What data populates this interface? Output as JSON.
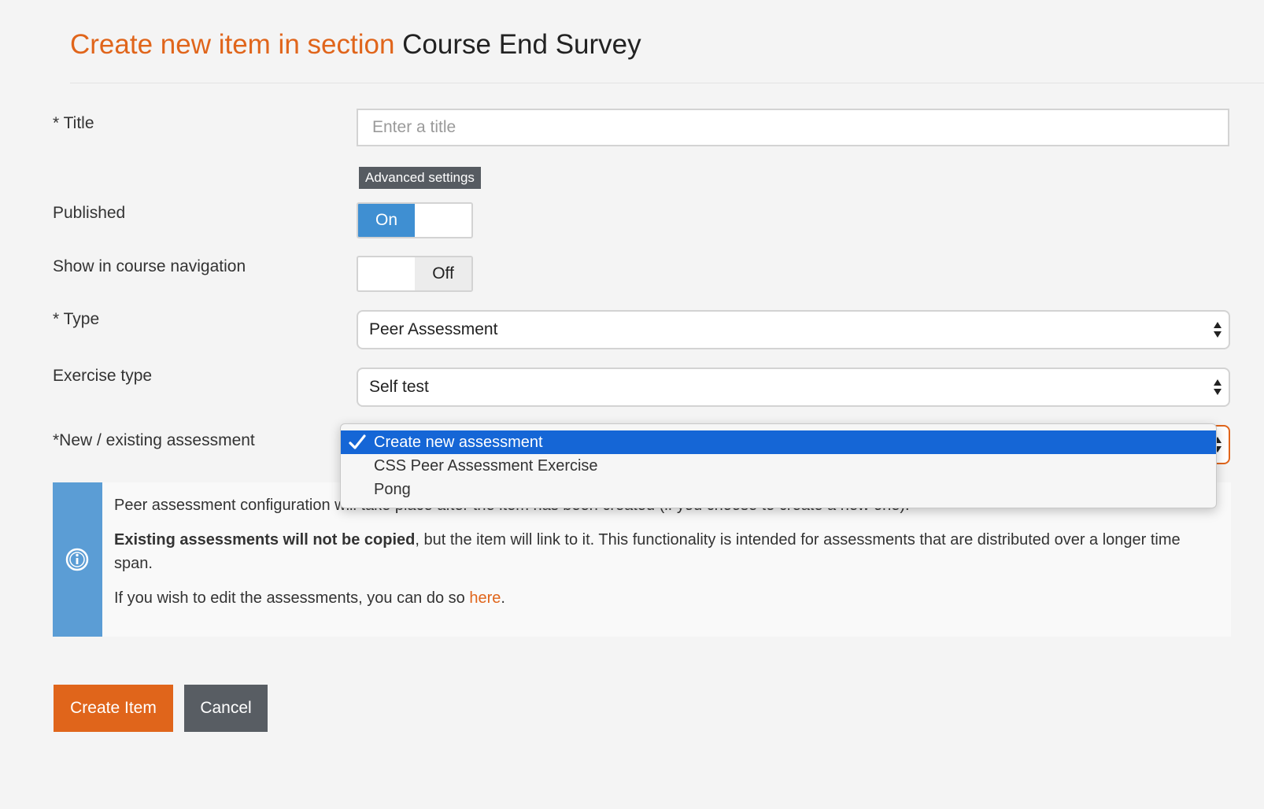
{
  "page": {
    "heading_prefix": "Create new item in section",
    "section_name": "Course End Survey"
  },
  "form": {
    "title": {
      "label": "* Title",
      "placeholder": "Enter a title",
      "value": ""
    },
    "advanced_settings_label": "Advanced settings",
    "published": {
      "label": "Published",
      "on_label": "On",
      "state": "on"
    },
    "show_in_nav": {
      "label": "Show in course navigation",
      "off_label": "Off",
      "state": "off"
    },
    "type": {
      "label": "* Type",
      "value": "Peer Assessment"
    },
    "exercise_type": {
      "label": "Exercise type",
      "value": "Self test"
    },
    "assessment": {
      "label": "*New / existing assessment",
      "options": [
        "Create new assessment",
        "CSS Peer Assessment Exercise",
        "Pong"
      ],
      "selected_index": 0
    }
  },
  "info": {
    "para1_visible": "Peer assessment configuration",
    "para1_hidden_tail": " will take place after the item has been created (if you choose to create a new one).",
    "para2_bold": "Existing assessments will not be copied",
    "para2_rest": ", but the item will link to it. This functionality is intended for assessments that are distributed over a longer time span.",
    "para3_text": "If you wish to edit the assessments, you can do so ",
    "para3_link": "here",
    "para3_end": "."
  },
  "actions": {
    "create_label": "Create Item",
    "cancel_label": "Cancel"
  },
  "colors": {
    "accent": "#e0651b",
    "toggle_on": "#3f8fd2",
    "dropdown_selected": "#1566d6",
    "info_bar": "#5b9dd5",
    "secondary_button": "#585d63"
  },
  "icons": [
    "check-icon",
    "info-icon",
    "select-arrows-icon"
  ]
}
